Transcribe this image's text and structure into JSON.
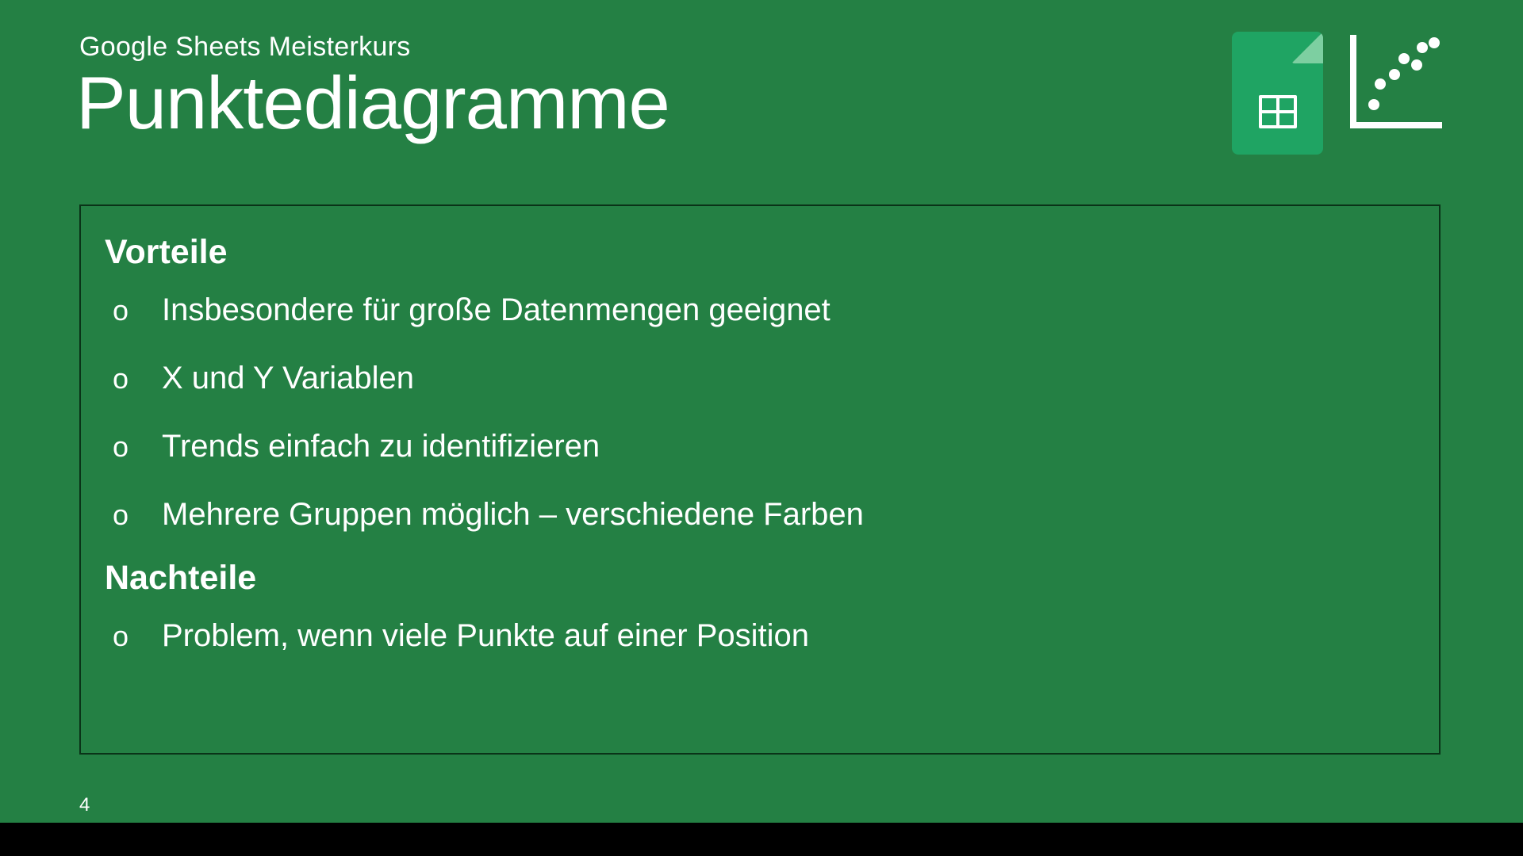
{
  "header": {
    "subtitle": "Google Sheets Meisterkurs",
    "title": "Punktediagramme"
  },
  "icons": {
    "sheets": "google-sheets-icon",
    "scatter": "scatter-chart-icon"
  },
  "sections": {
    "advantages": {
      "heading": "Vorteile",
      "items": [
        "Insbesondere für große Datenmengen geeignet",
        "X und Y Variablen",
        "Trends einfach zu identifizieren",
        "Mehrere Gruppen möglich  –  verschiedene Farben"
      ]
    },
    "disadvantages": {
      "heading": "Nachteile",
      "items": [
        "Problem, wenn viele Punkte auf einer Position"
      ]
    }
  },
  "page_number": "4",
  "bullet_char": "o"
}
